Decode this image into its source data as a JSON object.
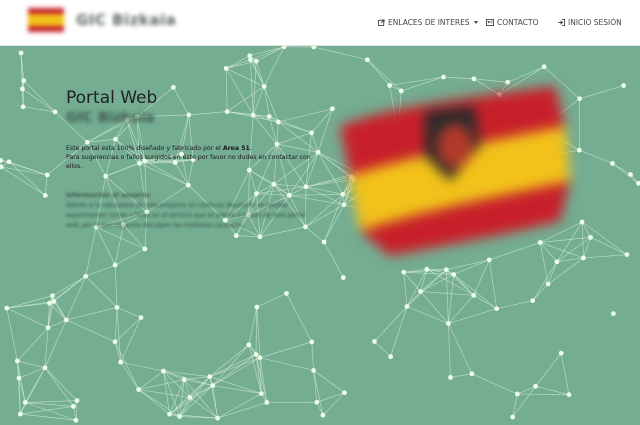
{
  "navbar": {
    "brand_name": "GIC Bizkaia",
    "brand_logo_icon": "spain-flag-logo-icon",
    "links": [
      {
        "label": "ENLACES DE INTERES",
        "icon": "external-link-icon",
        "dropdown": true
      },
      {
        "label": "CONTACTO",
        "icon": "contact-card-icon"
      },
      {
        "label": "INICIO SESIÓN",
        "icon": "sign-in-icon"
      }
    ]
  },
  "hero": {
    "title": "Portal Web",
    "subtitle": "GIC Bizkaia",
    "paragraph_line1_prefix": "Este portal esta 100% diseñado y fabricado por el ",
    "paragraph_line1_bold": "Area 51",
    "paragraph_line1_suffix": ".",
    "paragraph_line2": "Para sugerencias o fallos surgidos en éste por favor no dudes en contactar con ellos.",
    "info_title": "Información al usuario:",
    "info_text": "Debido a la naturaleza de este proyecto en continuo desarrollo es posible experimentar cortes o fallos en el servicio que se presta a través de este portal web, por lo que rogamos disculpen las molestias causadas."
  },
  "colors": {
    "background": "#74ad92",
    "network_line": "#cfe8d6",
    "network_node": "#eaffe4",
    "flag_red": "#c8202a",
    "flag_yellow": "#f2c21a"
  }
}
